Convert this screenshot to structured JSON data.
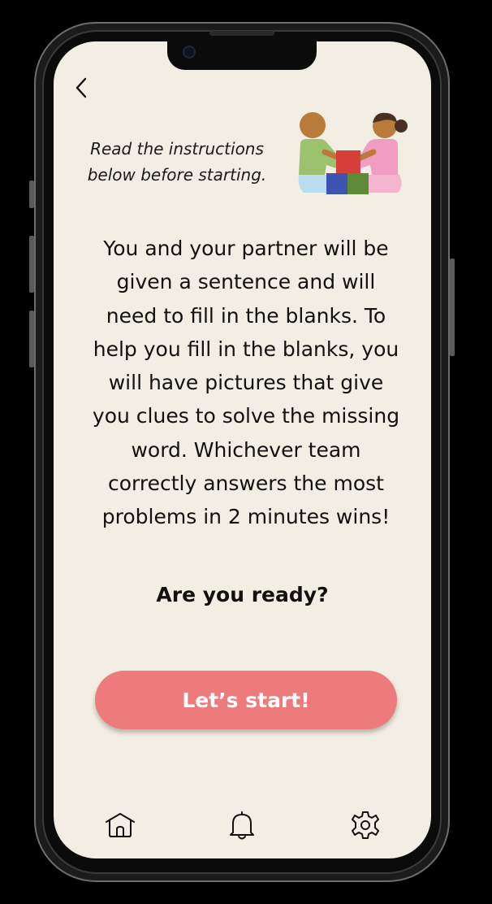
{
  "header": {
    "back_icon": "chevron-left-icon",
    "intro_line1": "Read the instructions",
    "intro_line2": "below before starting."
  },
  "illustration": {
    "name": "two-kids-playing-blocks",
    "colors": {
      "boy_skin": "#b97a3a",
      "boy_shirt": "#9cc26f",
      "girl_shirt": "#ef9dc0",
      "girl_hair": "#4b2f22",
      "block_red": "#d63f3a",
      "block_blue": "#3d55b0",
      "block_green": "#5c8a36",
      "legs_blue": "#b9dcef",
      "legs_pink": "#f4b6cf"
    }
  },
  "instructions": {
    "lines": [
      "You and your partner will be",
      "given a sentence and will",
      "need to fill in the blanks. To",
      "help you fill in the blanks, you",
      "will have pictures that give",
      "you clues to solve the missing",
      "word. Whichever team",
      "correctly answers the most",
      "problems in 2 minutes wins!"
    ]
  },
  "prompt": {
    "ready": "Are you ready?"
  },
  "actions": {
    "start_label": "Let’s start!"
  },
  "nav": {
    "items": [
      {
        "icon": "home-icon"
      },
      {
        "icon": "bell-icon"
      },
      {
        "icon": "gear-icon"
      }
    ]
  },
  "theme": {
    "background": "#f3eee3",
    "accent": "#ee7b7b",
    "text": "#111111"
  }
}
